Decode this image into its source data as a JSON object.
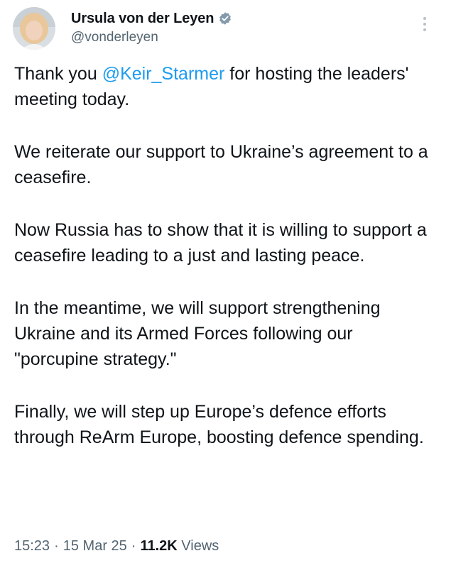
{
  "author": {
    "name": "Ursula von der Leyen",
    "handle": "@vonderleyen",
    "verified_icon": "verified-badge-icon",
    "avatar": "profile-photo"
  },
  "tweet": {
    "p1_before": "Thank you ",
    "p1_mention": "@Keir_Starmer",
    "p1_after": " for hosting the leaders' meeting today.",
    "p2": "We reiterate our support to Ukraine’s agreement to a ceasefire.",
    "p3": "Now Russia has to show that it is willing to support a ceasefire leading to a just and lasting peace.",
    "p4": "In the meantime, we will support strengthening Ukraine and its Armed Forces following our \"porcupine strategy.\"",
    "p5": "Finally, we will step up Europe’s defence efforts through ReArm Europe, boosting defence spending."
  },
  "meta": {
    "time": "15:23",
    "date": "15 Mar 25",
    "views_count": "11.2K",
    "views_label": "Views",
    "separator": "·"
  },
  "colors": {
    "link": "#1d9bf0",
    "secondary_text": "#536471",
    "primary_text": "#0f1419",
    "verified_badge": "#829aab"
  },
  "icons": {
    "more": "more-vertical-icon"
  }
}
